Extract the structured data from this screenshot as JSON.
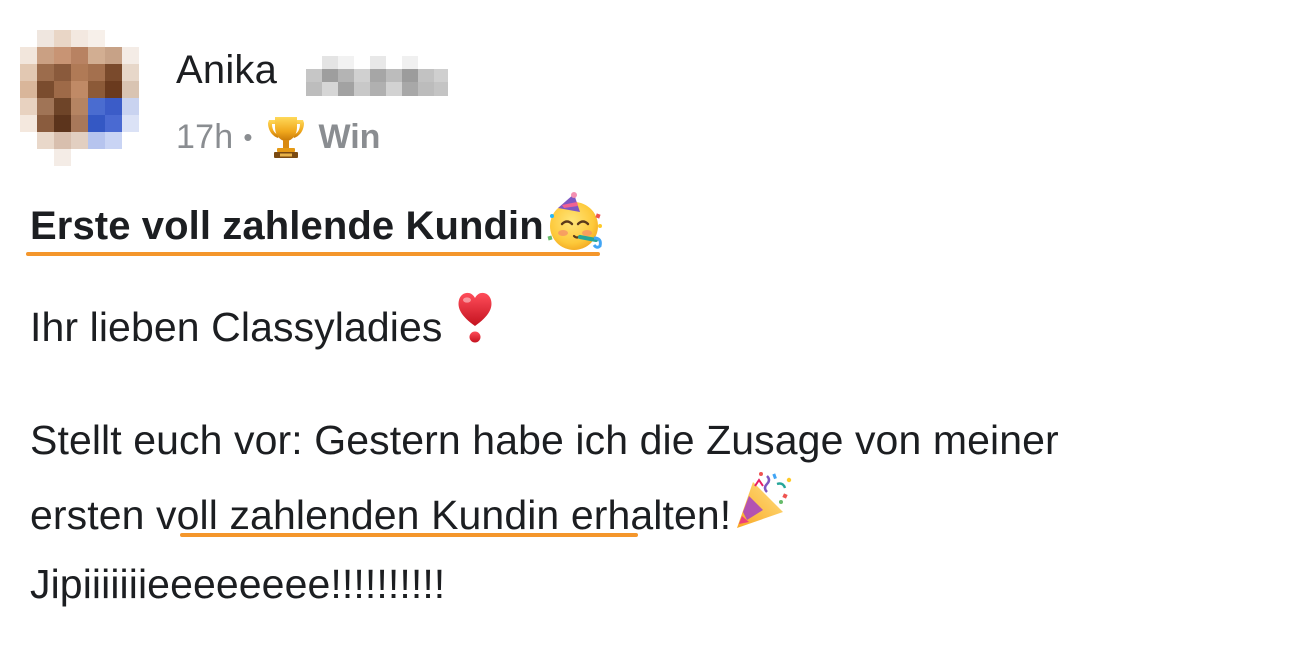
{
  "post": {
    "author": {
      "first_name": "Anika",
      "last_name_redacted": true
    },
    "meta": {
      "timestamp": "17h",
      "separator": "•",
      "category_icon": "trophy-icon",
      "category_label": "Win"
    },
    "headline": "Erste voll zahlende Kundin",
    "headline_emoji": "partying-face-emoji",
    "greeting": "Ihr lieben Classyladies",
    "greeting_emoji": "heart-exclamation-emoji",
    "body": {
      "line1": "Stellt euch vor: Gestern habe ich die Zusage von meiner",
      "line2_prefix": "ersten ",
      "line2_highlight": "voll zahlenden Kundin",
      "line2_suffix": " erhalten!",
      "line2_emoji": "party-popper-emoji",
      "line3": "Jipiiiiiiieeeeeeee!!!!!!!!!!"
    },
    "colors": {
      "text": "#1c1e21",
      "meta_text": "#8a8d91",
      "highlight_underline": "#f4962b"
    }
  }
}
